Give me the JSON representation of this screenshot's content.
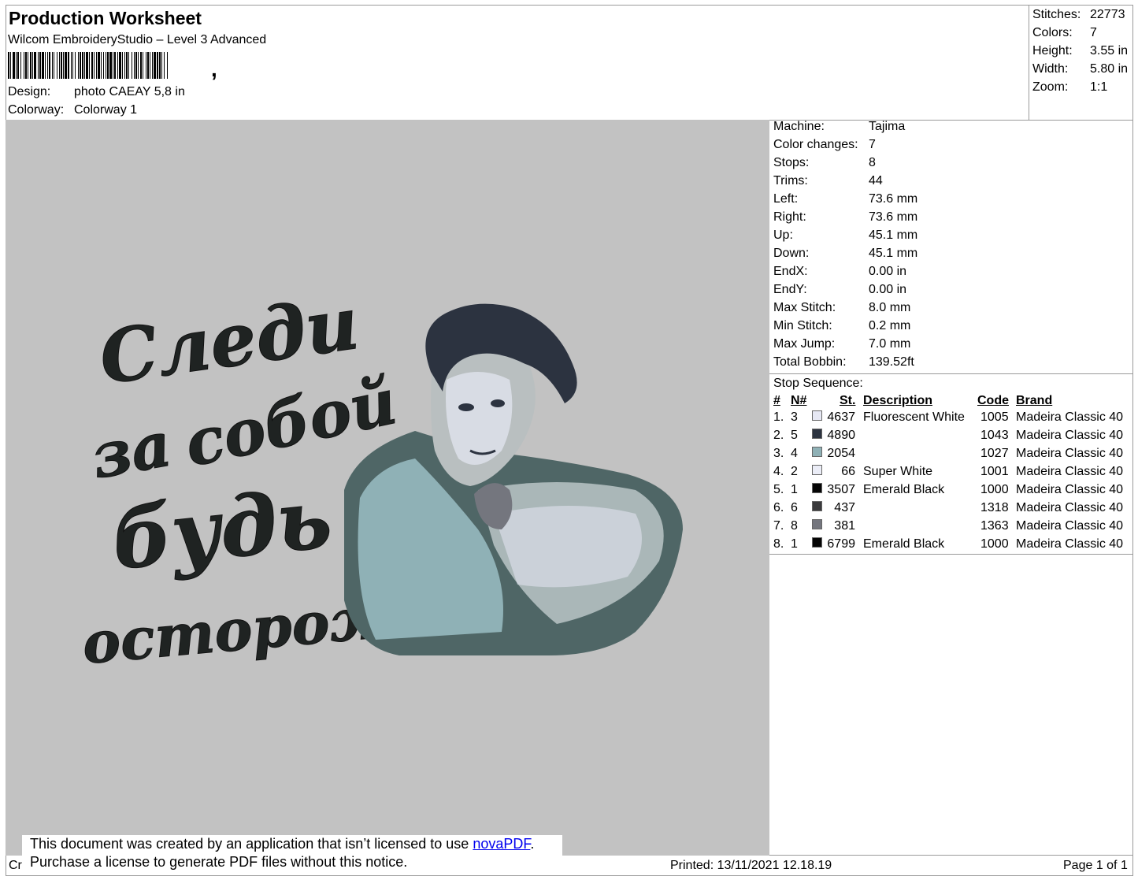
{
  "header": {
    "title": "Production Worksheet",
    "software": "Wilcom EmbroideryStudio – Level 3 Advanced",
    "design_label": "Design:",
    "design_value": "photo CAEAY 5,8 in",
    "colorway_label": "Colorway:",
    "colorway_value": "Colorway 1",
    "barcode_comma": ","
  },
  "summary": [
    {
      "label": "Stitches:",
      "value": "22773"
    },
    {
      "label": "Colors:",
      "value": "7"
    },
    {
      "label": "Height:",
      "value": "3.55 in"
    },
    {
      "label": "Width:",
      "value": "5.80 in"
    },
    {
      "label": "Zoom:",
      "value": "1:1"
    }
  ],
  "machine_info": [
    {
      "label": "Machine:",
      "value": "Tajima"
    },
    {
      "label": "Color changes:",
      "value": "7"
    },
    {
      "label": "Stops:",
      "value": "8"
    },
    {
      "label": "Trims:",
      "value": "44"
    },
    {
      "label": "Left:",
      "value": "73.6 mm"
    },
    {
      "label": "Right:",
      "value": "73.6 mm"
    },
    {
      "label": "Up:",
      "value": "45.1 mm"
    },
    {
      "label": "Down:",
      "value": "45.1 mm"
    },
    {
      "label": "EndX:",
      "value": "0.00 in"
    },
    {
      "label": "EndY:",
      "value": "0.00 in"
    },
    {
      "label": "Max Stitch:",
      "value": "8.0 mm"
    },
    {
      "label": "Min Stitch:",
      "value": "0.2 mm"
    },
    {
      "label": "Max Jump:",
      "value": "7.0 mm"
    },
    {
      "label": "Total Bobbin:",
      "value": "139.52ft"
    }
  ],
  "stop_sequence": {
    "title": "Stop Sequence:",
    "headers": {
      "index": "#",
      "needle": "N#",
      "stitches": "St.",
      "description": "Description",
      "code": "Code",
      "brand": "Brand"
    },
    "rows": [
      {
        "index": "1.",
        "needle": "3",
        "color": "#e6e8f4",
        "stitches": "4637",
        "description": "Fluorescent White",
        "code": "1005",
        "brand": "Madeira Classic 40"
      },
      {
        "index": "2.",
        "needle": "5",
        "color": "#2c3340",
        "stitches": "4890",
        "description": "",
        "code": "1043",
        "brand": "Madeira Classic 40"
      },
      {
        "index": "3.",
        "needle": "4",
        "color": "#8fb1b6",
        "stitches": "2054",
        "description": "",
        "code": "1027",
        "brand": "Madeira Classic 40"
      },
      {
        "index": "4.",
        "needle": "2",
        "color": "#ebedf7",
        "stitches": "66",
        "description": "Super White",
        "code": "1001",
        "brand": "Madeira Classic 40"
      },
      {
        "index": "5.",
        "needle": "1",
        "color": "#050505",
        "stitches": "3507",
        "description": "Emerald Black",
        "code": "1000",
        "brand": "Madeira Classic 40"
      },
      {
        "index": "6.",
        "needle": "6",
        "color": "#3a3a3c",
        "stitches": "437",
        "description": "",
        "code": "1318",
        "brand": "Madeira Classic 40"
      },
      {
        "index": "7.",
        "needle": "8",
        "color": "#74767e",
        "stitches": "381",
        "description": "",
        "code": "1363",
        "brand": "Madeira Classic 40"
      },
      {
        "index": "8.",
        "needle": "1",
        "color": "#050505",
        "stitches": "6799",
        "description": "Emerald Black",
        "code": "1000",
        "brand": "Madeira Classic 40"
      }
    ]
  },
  "design_preview": {
    "lettering": [
      "Следи",
      "за",
      "собой",
      "будь",
      "осторожен"
    ]
  },
  "footer": {
    "left_fragment": "Cr",
    "printed": "Printed: 13/11/2021 12.18.19",
    "page": "Page 1 of 1"
  },
  "notice": {
    "line1_text": "This document was created by an application that isn’t licensed to use ",
    "link": "novaPDF",
    "line1_end": ".",
    "line2": "Purchase a license to generate PDF files without this notice."
  }
}
